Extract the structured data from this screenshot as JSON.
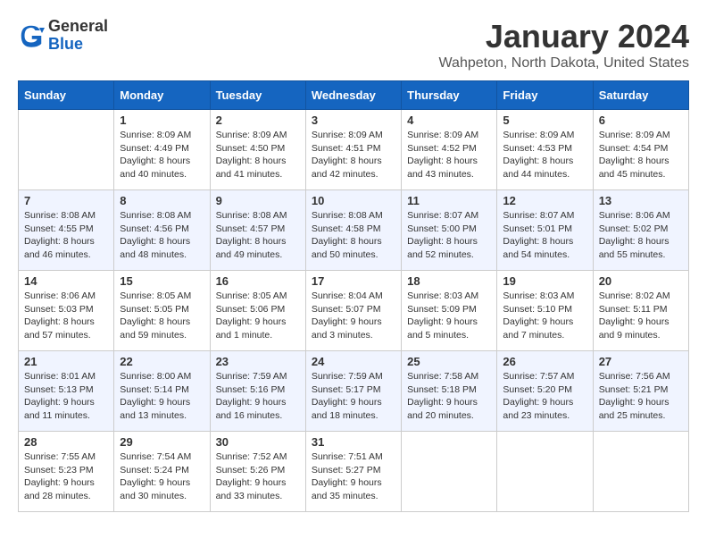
{
  "header": {
    "logo_line1": "General",
    "logo_line2": "Blue",
    "month": "January 2024",
    "location": "Wahpeton, North Dakota, United States"
  },
  "weekdays": [
    "Sunday",
    "Monday",
    "Tuesday",
    "Wednesday",
    "Thursday",
    "Friday",
    "Saturday"
  ],
  "weeks": [
    [
      {
        "day": "",
        "sunrise": "",
        "sunset": "",
        "daylight": ""
      },
      {
        "day": "1",
        "sunrise": "Sunrise: 8:09 AM",
        "sunset": "Sunset: 4:49 PM",
        "daylight": "Daylight: 8 hours and 40 minutes."
      },
      {
        "day": "2",
        "sunrise": "Sunrise: 8:09 AM",
        "sunset": "Sunset: 4:50 PM",
        "daylight": "Daylight: 8 hours and 41 minutes."
      },
      {
        "day": "3",
        "sunrise": "Sunrise: 8:09 AM",
        "sunset": "Sunset: 4:51 PM",
        "daylight": "Daylight: 8 hours and 42 minutes."
      },
      {
        "day": "4",
        "sunrise": "Sunrise: 8:09 AM",
        "sunset": "Sunset: 4:52 PM",
        "daylight": "Daylight: 8 hours and 43 minutes."
      },
      {
        "day": "5",
        "sunrise": "Sunrise: 8:09 AM",
        "sunset": "Sunset: 4:53 PM",
        "daylight": "Daylight: 8 hours and 44 minutes."
      },
      {
        "day": "6",
        "sunrise": "Sunrise: 8:09 AM",
        "sunset": "Sunset: 4:54 PM",
        "daylight": "Daylight: 8 hours and 45 minutes."
      }
    ],
    [
      {
        "day": "7",
        "sunrise": "Sunrise: 8:08 AM",
        "sunset": "Sunset: 4:55 PM",
        "daylight": "Daylight: 8 hours and 46 minutes."
      },
      {
        "day": "8",
        "sunrise": "Sunrise: 8:08 AM",
        "sunset": "Sunset: 4:56 PM",
        "daylight": "Daylight: 8 hours and 48 minutes."
      },
      {
        "day": "9",
        "sunrise": "Sunrise: 8:08 AM",
        "sunset": "Sunset: 4:57 PM",
        "daylight": "Daylight: 8 hours and 49 minutes."
      },
      {
        "day": "10",
        "sunrise": "Sunrise: 8:08 AM",
        "sunset": "Sunset: 4:58 PM",
        "daylight": "Daylight: 8 hours and 50 minutes."
      },
      {
        "day": "11",
        "sunrise": "Sunrise: 8:07 AM",
        "sunset": "Sunset: 5:00 PM",
        "daylight": "Daylight: 8 hours and 52 minutes."
      },
      {
        "day": "12",
        "sunrise": "Sunrise: 8:07 AM",
        "sunset": "Sunset: 5:01 PM",
        "daylight": "Daylight: 8 hours and 54 minutes."
      },
      {
        "day": "13",
        "sunrise": "Sunrise: 8:06 AM",
        "sunset": "Sunset: 5:02 PM",
        "daylight": "Daylight: 8 hours and 55 minutes."
      }
    ],
    [
      {
        "day": "14",
        "sunrise": "Sunrise: 8:06 AM",
        "sunset": "Sunset: 5:03 PM",
        "daylight": "Daylight: 8 hours and 57 minutes."
      },
      {
        "day": "15",
        "sunrise": "Sunrise: 8:05 AM",
        "sunset": "Sunset: 5:05 PM",
        "daylight": "Daylight: 8 hours and 59 minutes."
      },
      {
        "day": "16",
        "sunrise": "Sunrise: 8:05 AM",
        "sunset": "Sunset: 5:06 PM",
        "daylight": "Daylight: 9 hours and 1 minute."
      },
      {
        "day": "17",
        "sunrise": "Sunrise: 8:04 AM",
        "sunset": "Sunset: 5:07 PM",
        "daylight": "Daylight: 9 hours and 3 minutes."
      },
      {
        "day": "18",
        "sunrise": "Sunrise: 8:03 AM",
        "sunset": "Sunset: 5:09 PM",
        "daylight": "Daylight: 9 hours and 5 minutes."
      },
      {
        "day": "19",
        "sunrise": "Sunrise: 8:03 AM",
        "sunset": "Sunset: 5:10 PM",
        "daylight": "Daylight: 9 hours and 7 minutes."
      },
      {
        "day": "20",
        "sunrise": "Sunrise: 8:02 AM",
        "sunset": "Sunset: 5:11 PM",
        "daylight": "Daylight: 9 hours and 9 minutes."
      }
    ],
    [
      {
        "day": "21",
        "sunrise": "Sunrise: 8:01 AM",
        "sunset": "Sunset: 5:13 PM",
        "daylight": "Daylight: 9 hours and 11 minutes."
      },
      {
        "day": "22",
        "sunrise": "Sunrise: 8:00 AM",
        "sunset": "Sunset: 5:14 PM",
        "daylight": "Daylight: 9 hours and 13 minutes."
      },
      {
        "day": "23",
        "sunrise": "Sunrise: 7:59 AM",
        "sunset": "Sunset: 5:16 PM",
        "daylight": "Daylight: 9 hours and 16 minutes."
      },
      {
        "day": "24",
        "sunrise": "Sunrise: 7:59 AM",
        "sunset": "Sunset: 5:17 PM",
        "daylight": "Daylight: 9 hours and 18 minutes."
      },
      {
        "day": "25",
        "sunrise": "Sunrise: 7:58 AM",
        "sunset": "Sunset: 5:18 PM",
        "daylight": "Daylight: 9 hours and 20 minutes."
      },
      {
        "day": "26",
        "sunrise": "Sunrise: 7:57 AM",
        "sunset": "Sunset: 5:20 PM",
        "daylight": "Daylight: 9 hours and 23 minutes."
      },
      {
        "day": "27",
        "sunrise": "Sunrise: 7:56 AM",
        "sunset": "Sunset: 5:21 PM",
        "daylight": "Daylight: 9 hours and 25 minutes."
      }
    ],
    [
      {
        "day": "28",
        "sunrise": "Sunrise: 7:55 AM",
        "sunset": "Sunset: 5:23 PM",
        "daylight": "Daylight: 9 hours and 28 minutes."
      },
      {
        "day": "29",
        "sunrise": "Sunrise: 7:54 AM",
        "sunset": "Sunset: 5:24 PM",
        "daylight": "Daylight: 9 hours and 30 minutes."
      },
      {
        "day": "30",
        "sunrise": "Sunrise: 7:52 AM",
        "sunset": "Sunset: 5:26 PM",
        "daylight": "Daylight: 9 hours and 33 minutes."
      },
      {
        "day": "31",
        "sunrise": "Sunrise: 7:51 AM",
        "sunset": "Sunset: 5:27 PM",
        "daylight": "Daylight: 9 hours and 35 minutes."
      },
      {
        "day": "",
        "sunrise": "",
        "sunset": "",
        "daylight": ""
      },
      {
        "day": "",
        "sunrise": "",
        "sunset": "",
        "daylight": ""
      },
      {
        "day": "",
        "sunrise": "",
        "sunset": "",
        "daylight": ""
      }
    ]
  ]
}
